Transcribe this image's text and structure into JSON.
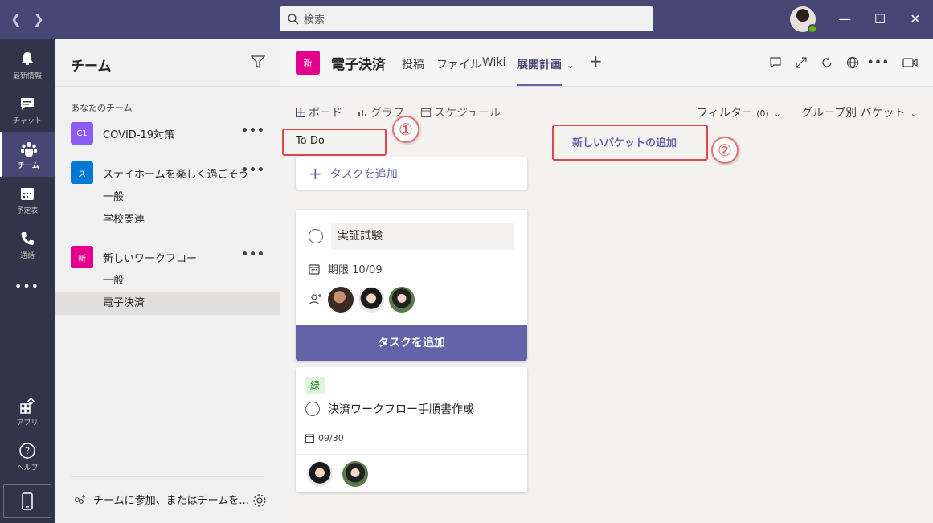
{
  "search": {
    "placeholder": "検索"
  },
  "rail": {
    "items": [
      {
        "label": "最新情報",
        "icon": "bell-icon"
      },
      {
        "label": "チャット",
        "icon": "chat-icon"
      },
      {
        "label": "チーム",
        "icon": "teams-icon"
      },
      {
        "label": "予定表",
        "icon": "calendar-icon"
      },
      {
        "label": "通話",
        "icon": "phone-icon"
      },
      {
        "label": "アプリ",
        "icon": "apps-icon"
      },
      {
        "label": "ヘルプ",
        "icon": "help-icon"
      }
    ]
  },
  "panel": {
    "title": "チーム",
    "section_label": "あなたのチーム",
    "teams": [
      {
        "tile": "C1",
        "name": "COVID-19対策",
        "color": "#8b5cf6"
      },
      {
        "tile": "ス",
        "name": "ステイホームを楽しく過ごそう",
        "color": "#0078d4",
        "channels": [
          "一般",
          "学校関連"
        ]
      },
      {
        "tile": "新",
        "name": "新しいワークフロー",
        "color": "#e3008c",
        "channels": [
          "一般",
          "電子決済"
        ]
      }
    ],
    "join_text": "チームに参加、またはチームを…"
  },
  "channel_header": {
    "tile": "新",
    "title": "電子決済",
    "tabs": [
      "投稿",
      "ファイル",
      "Wiki",
      "展開計画"
    ],
    "active_tab": "展開計画"
  },
  "planner": {
    "views": [
      "ボード",
      "グラフ",
      "スケジュール"
    ],
    "filter_label": "フィルター",
    "filter_count": "(0)",
    "group_label": "グループ別 バケット",
    "bucket_title": "To Do",
    "add_task_label": "タスクを追加",
    "add_bucket_label": "新しいバケットの追加",
    "badge_1": "①",
    "badge_2": "②",
    "new_task": {
      "title": "実証試験",
      "due": "期限 10/09",
      "submit_label": "タスクを追加"
    },
    "task": {
      "label": "緑",
      "title": "決済ワークフロー手順書作成",
      "due": "09/30"
    }
  },
  "colors": {
    "titlebar": "#464775",
    "rail": "#33344a",
    "accent": "#6264a7",
    "highlight": "#e0474c"
  }
}
